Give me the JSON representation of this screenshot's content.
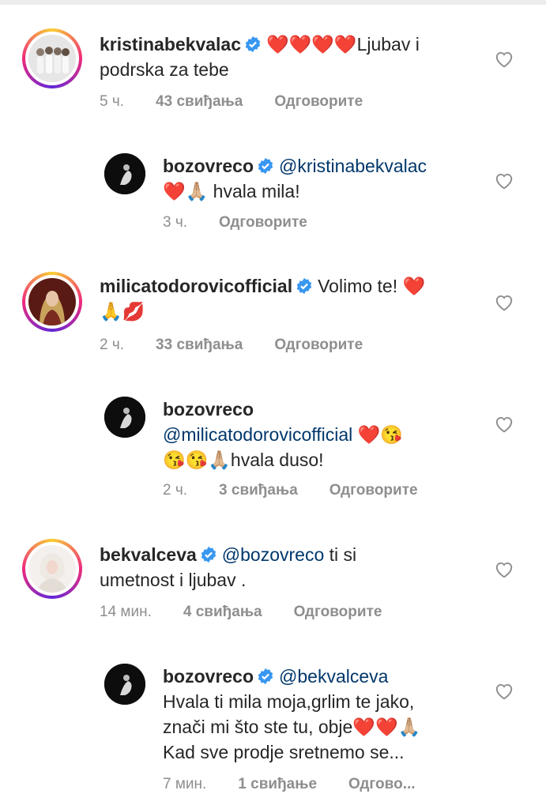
{
  "comments": [
    {
      "username": "kristinabekvalac",
      "text_lines": [
        "❤️❤️❤️❤️Ljubav i",
        "podrska za tebe"
      ],
      "time": "5 ч.",
      "likes": "43 свиђања",
      "reply": "Одговорите"
    },
    {
      "username": "bozovreco",
      "mention": "@kristinabekvalac",
      "text_lines": [
        "❤️🙏🏼 hvala mila!"
      ],
      "time": "3 ч.",
      "reply": "Одговорите"
    },
    {
      "username": "milicatodorovicofficial",
      "text_first": "Volimo te! ❤️",
      "text_lines": [
        "🙏💋"
      ],
      "time": "2 ч.",
      "likes": "33 свиђања",
      "reply": "Одговорите"
    },
    {
      "username": "bozovreco",
      "mention": "@milicatodorovicofficial",
      "mention_tail": "❤️😘",
      "text_lines": [
        "😘😘🙏🏼hvala duso!"
      ],
      "time": "2 ч.",
      "likes": "3 свиђања",
      "reply": "Одговорите"
    },
    {
      "username": "bekvalceva",
      "mention": "@bozovreco",
      "text_first": " ti si",
      "text_lines": [
        "umetnost i ljubav ."
      ],
      "time": "14 мин.",
      "likes": "4 свиђања",
      "reply": "Одговорите"
    },
    {
      "username": "bozovreco",
      "mention": "@bekvalceva",
      "text_lines": [
        "Hvala ti mila moja,grlim te jako,",
        "znači mi što ste tu, obje❤️❤️🙏🏼",
        "Kad sve prodje sretnemo se..."
      ],
      "time": "7 мин.",
      "likes": "1 свиђање",
      "reply": "Одгово..."
    }
  ],
  "colors": {
    "verified": "#3897f0",
    "mention": "#00376b",
    "meta": "#8e8e8e",
    "heart_emoji": "#e0222f"
  },
  "icons": {
    "verified": "verified-badge-icon",
    "like": "heart-outline-icon"
  }
}
